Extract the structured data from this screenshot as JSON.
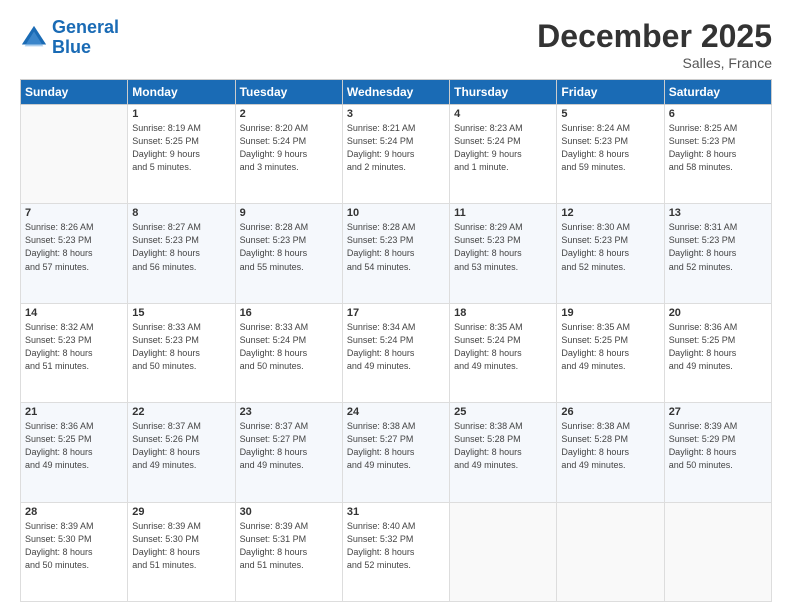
{
  "header": {
    "logo_line1": "General",
    "logo_line2": "Blue",
    "month": "December 2025",
    "location": "Salles, France"
  },
  "days_of_week": [
    "Sunday",
    "Monday",
    "Tuesday",
    "Wednesday",
    "Thursday",
    "Friday",
    "Saturday"
  ],
  "weeks": [
    [
      {
        "day": "",
        "info": ""
      },
      {
        "day": "1",
        "info": "Sunrise: 8:19 AM\nSunset: 5:25 PM\nDaylight: 9 hours\nand 5 minutes."
      },
      {
        "day": "2",
        "info": "Sunrise: 8:20 AM\nSunset: 5:24 PM\nDaylight: 9 hours\nand 3 minutes."
      },
      {
        "day": "3",
        "info": "Sunrise: 8:21 AM\nSunset: 5:24 PM\nDaylight: 9 hours\nand 2 minutes."
      },
      {
        "day": "4",
        "info": "Sunrise: 8:23 AM\nSunset: 5:24 PM\nDaylight: 9 hours\nand 1 minute."
      },
      {
        "day": "5",
        "info": "Sunrise: 8:24 AM\nSunset: 5:23 PM\nDaylight: 8 hours\nand 59 minutes."
      },
      {
        "day": "6",
        "info": "Sunrise: 8:25 AM\nSunset: 5:23 PM\nDaylight: 8 hours\nand 58 minutes."
      }
    ],
    [
      {
        "day": "7",
        "info": "Sunrise: 8:26 AM\nSunset: 5:23 PM\nDaylight: 8 hours\nand 57 minutes."
      },
      {
        "day": "8",
        "info": "Sunrise: 8:27 AM\nSunset: 5:23 PM\nDaylight: 8 hours\nand 56 minutes."
      },
      {
        "day": "9",
        "info": "Sunrise: 8:28 AM\nSunset: 5:23 PM\nDaylight: 8 hours\nand 55 minutes."
      },
      {
        "day": "10",
        "info": "Sunrise: 8:28 AM\nSunset: 5:23 PM\nDaylight: 8 hours\nand 54 minutes."
      },
      {
        "day": "11",
        "info": "Sunrise: 8:29 AM\nSunset: 5:23 PM\nDaylight: 8 hours\nand 53 minutes."
      },
      {
        "day": "12",
        "info": "Sunrise: 8:30 AM\nSunset: 5:23 PM\nDaylight: 8 hours\nand 52 minutes."
      },
      {
        "day": "13",
        "info": "Sunrise: 8:31 AM\nSunset: 5:23 PM\nDaylight: 8 hours\nand 52 minutes."
      }
    ],
    [
      {
        "day": "14",
        "info": "Sunrise: 8:32 AM\nSunset: 5:23 PM\nDaylight: 8 hours\nand 51 minutes."
      },
      {
        "day": "15",
        "info": "Sunrise: 8:33 AM\nSunset: 5:23 PM\nDaylight: 8 hours\nand 50 minutes."
      },
      {
        "day": "16",
        "info": "Sunrise: 8:33 AM\nSunset: 5:24 PM\nDaylight: 8 hours\nand 50 minutes."
      },
      {
        "day": "17",
        "info": "Sunrise: 8:34 AM\nSunset: 5:24 PM\nDaylight: 8 hours\nand 49 minutes."
      },
      {
        "day": "18",
        "info": "Sunrise: 8:35 AM\nSunset: 5:24 PM\nDaylight: 8 hours\nand 49 minutes."
      },
      {
        "day": "19",
        "info": "Sunrise: 8:35 AM\nSunset: 5:25 PM\nDaylight: 8 hours\nand 49 minutes."
      },
      {
        "day": "20",
        "info": "Sunrise: 8:36 AM\nSunset: 5:25 PM\nDaylight: 8 hours\nand 49 minutes."
      }
    ],
    [
      {
        "day": "21",
        "info": "Sunrise: 8:36 AM\nSunset: 5:25 PM\nDaylight: 8 hours\nand 49 minutes."
      },
      {
        "day": "22",
        "info": "Sunrise: 8:37 AM\nSunset: 5:26 PM\nDaylight: 8 hours\nand 49 minutes."
      },
      {
        "day": "23",
        "info": "Sunrise: 8:37 AM\nSunset: 5:27 PM\nDaylight: 8 hours\nand 49 minutes."
      },
      {
        "day": "24",
        "info": "Sunrise: 8:38 AM\nSunset: 5:27 PM\nDaylight: 8 hours\nand 49 minutes."
      },
      {
        "day": "25",
        "info": "Sunrise: 8:38 AM\nSunset: 5:28 PM\nDaylight: 8 hours\nand 49 minutes."
      },
      {
        "day": "26",
        "info": "Sunrise: 8:38 AM\nSunset: 5:28 PM\nDaylight: 8 hours\nand 49 minutes."
      },
      {
        "day": "27",
        "info": "Sunrise: 8:39 AM\nSunset: 5:29 PM\nDaylight: 8 hours\nand 50 minutes."
      }
    ],
    [
      {
        "day": "28",
        "info": "Sunrise: 8:39 AM\nSunset: 5:30 PM\nDaylight: 8 hours\nand 50 minutes."
      },
      {
        "day": "29",
        "info": "Sunrise: 8:39 AM\nSunset: 5:30 PM\nDaylight: 8 hours\nand 51 minutes."
      },
      {
        "day": "30",
        "info": "Sunrise: 8:39 AM\nSunset: 5:31 PM\nDaylight: 8 hours\nand 51 minutes."
      },
      {
        "day": "31",
        "info": "Sunrise: 8:40 AM\nSunset: 5:32 PM\nDaylight: 8 hours\nand 52 minutes."
      },
      {
        "day": "",
        "info": ""
      },
      {
        "day": "",
        "info": ""
      },
      {
        "day": "",
        "info": ""
      }
    ]
  ]
}
